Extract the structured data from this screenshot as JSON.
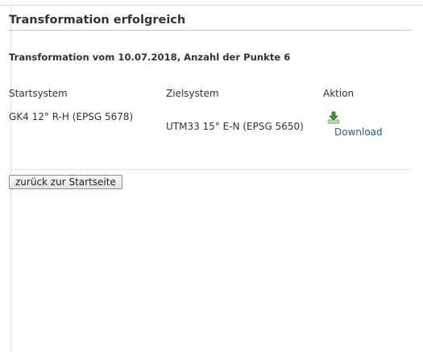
{
  "page": {
    "title": "Transformation erfolgreich",
    "subtitle": "Transformation vom 10.07.2018, Anzahl der Punkte 6"
  },
  "table": {
    "headers": [
      "Startsystem",
      "Zielsystem",
      "Aktion"
    ],
    "rows": [
      {
        "start": "GK4 12° R-H (EPSG 5678)",
        "target": "UTM33 15° E-N (EPSG 5650)",
        "action_label": "Download",
        "action_icon": "download-icon"
      }
    ]
  },
  "buttons": {
    "back_label": "zurück zur Startseite"
  },
  "colors": {
    "link": "#1f5d9a",
    "title_rule": "#b9c7d9",
    "icon_green": "#3a9a2b"
  }
}
